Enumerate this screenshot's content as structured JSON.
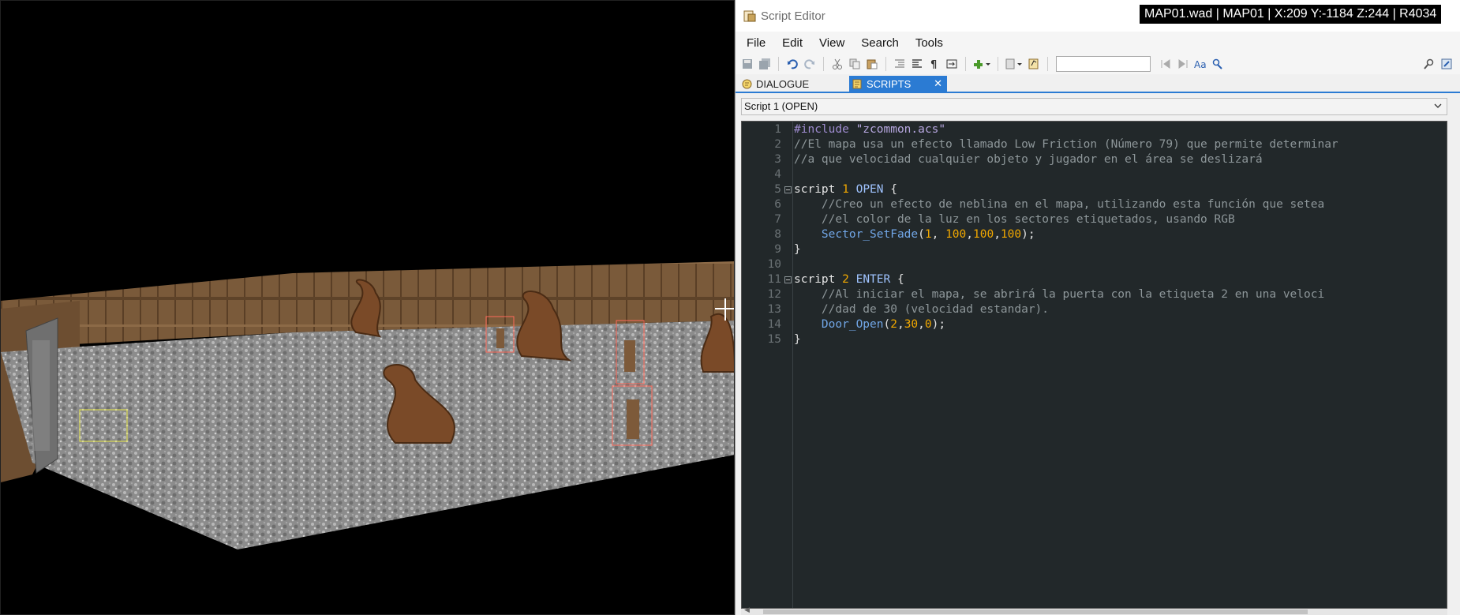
{
  "viewport": {
    "description_icons": [
      "tree-thing",
      "zombieman",
      "door",
      "ammo-box"
    ]
  },
  "status_readout": "MAP01.wad | MAP01 | X:209 Y:-1184 Z:244 | R4034",
  "window": {
    "title": "Script Editor"
  },
  "menu": [
    "File",
    "Edit",
    "View",
    "Search",
    "Tools"
  ],
  "toolbar": {
    "find_value": "",
    "buttons": [
      "save-icon",
      "save-all-icon",
      "undo-icon",
      "redo-icon",
      "cut-icon",
      "copy-icon",
      "paste-icon",
      "indent-icon",
      "unindent-icon",
      "whitespace-icon",
      "wordwrap-icon",
      "insert-snippet-icon",
      "compile-icon",
      "script-check-icon",
      "find-prev-icon",
      "find-next-icon",
      "match-case-icon",
      "find-replace-icon",
      "search-icon",
      "options-icon"
    ]
  },
  "tabs": [
    {
      "label": "DIALOGUE",
      "active": false
    },
    {
      "label": "SCRIPTS",
      "active": true
    }
  ],
  "script_select": "Script 1 (OPEN)",
  "code": {
    "lines": [
      {
        "n": "1",
        "text": "#include \"zcommon.acs\""
      },
      {
        "n": "2",
        "text": "//El mapa usa un efecto llamado Low Friction (Número 79) que permite determinar"
      },
      {
        "n": "3",
        "text": "//a que velocidad cualquier objeto y jugador en el área se deslizará"
      },
      {
        "n": "4",
        "text": ""
      },
      {
        "n": "5",
        "text": "script 1 OPEN {"
      },
      {
        "n": "6",
        "text": "    //Creo un efecto de neblina en el mapa, utilizando esta función que setea"
      },
      {
        "n": "7",
        "text": "    //el color de la luz en los sectores etiquetados, usando RGB"
      },
      {
        "n": "8",
        "text": "    Sector_SetFade(1, 100,100,100);"
      },
      {
        "n": "9",
        "text": "}"
      },
      {
        "n": "10",
        "text": ""
      },
      {
        "n": "11",
        "text": "script 2 ENTER {"
      },
      {
        "n": "12",
        "text": "    //Al iniciar el mapa, se abrirá la puerta con la etiqueta 2 en una veloci"
      },
      {
        "n": "13",
        "text": "    //dad de 30 (velocidad estandar)."
      },
      {
        "n": "14",
        "text": "    Door_Open(2,30,0);"
      },
      {
        "n": "15",
        "text": "}"
      }
    ]
  },
  "colors": {
    "editor_bg": "#22282a",
    "tab_active": "#2b7bd3",
    "number": "#f1a800",
    "comment": "#8d9699",
    "function": "#71a6e6"
  }
}
